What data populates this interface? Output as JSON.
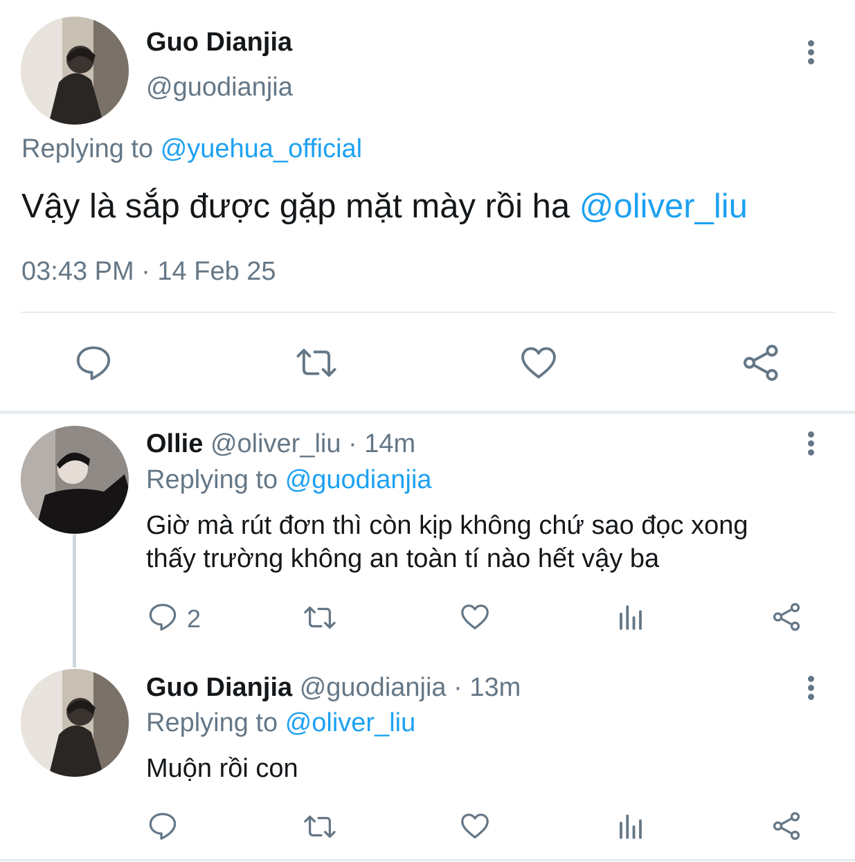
{
  "main_tweet": {
    "author_name": "Guo Dianjia",
    "author_handle": "@guodianjia",
    "replying_prefix": "Replying to",
    "replying_handle": "@yuehua_official",
    "text": "Vậy là sắp được gặp mặt mày rồi ha",
    "mention": "@oliver_liu",
    "timestamp": "03:43 PM · 14 Feb 25"
  },
  "replies": [
    {
      "author_name": "Ollie",
      "author_handle": "@oliver_liu",
      "time": "· 14m",
      "replying_prefix": "Replying to",
      "replying_handle": "@guodianjia",
      "text_line1": "Giờ mà rút đơn thì còn kịp không chứ sao đọc xong",
      "text_line2": "thấy trường không an toàn tí nào hết vậy ba",
      "reply_count": "2"
    },
    {
      "author_name": "Guo Dianjia",
      "author_handle": "@guodianjia",
      "time": "· 13m",
      "replying_prefix": "Replying to",
      "replying_handle": "@oliver_liu",
      "text": "Muộn rồi con",
      "reply_count": ""
    }
  ],
  "icons": {
    "main_actions": [
      "reply-icon",
      "retweet-icon",
      "like-icon",
      "share-icon"
    ],
    "reply_actions": [
      "reply-icon",
      "retweet-icon",
      "like-icon",
      "analytics-icon",
      "share-icon"
    ],
    "menu": "more-options-icon"
  },
  "colors": {
    "link": "#1da1f2",
    "muted": "#657786",
    "divider": "#e6ecf0",
    "text": "#14171a"
  }
}
